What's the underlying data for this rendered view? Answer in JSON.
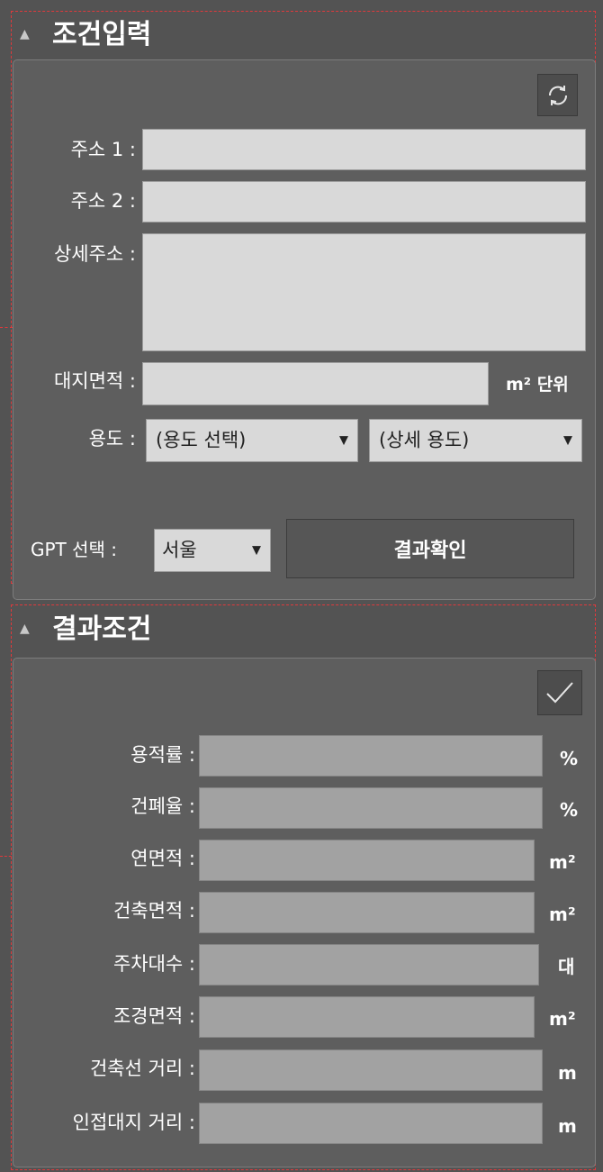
{
  "condition_section": {
    "title": "조건입력",
    "address1_label": "주소 1 :",
    "address2_label": "주소 2 :",
    "detail_address_label": "상세주소 :",
    "site_area_label": "대지면적 :",
    "site_area_unit": "m² 단위",
    "usage_label": "용도 :",
    "usage_select_value": "(용도 선택)",
    "detail_usage_select_value": "(상세 용도)",
    "gpt_label": "GPT 선택 :",
    "gpt_select_value": "서울",
    "confirm_button": "결과확인"
  },
  "result_section": {
    "title": "결과조건",
    "rows": [
      {
        "label": "용적률 :",
        "unit": "%"
      },
      {
        "label": "건폐율 :",
        "unit": "%"
      },
      {
        "label": "연면적 :",
        "unit": "m²"
      },
      {
        "label": "건축면적 :",
        "unit": "m²"
      },
      {
        "label": "주차대수 :",
        "unit": "대"
      },
      {
        "label": "조경면적 :",
        "unit": "m²"
      },
      {
        "label": "건축선 거리 :",
        "unit": "m"
      },
      {
        "label": "인접대지 거리 :",
        "unit": "m"
      }
    ]
  },
  "colors": {
    "background": "#535353",
    "panel": "#5e5e5e",
    "input_light": "#d9d9d9",
    "input_dark": "#a2a2a2",
    "dashed_outline": "#e0393c"
  },
  "icons": {
    "refresh": "refresh-icon",
    "check": "check-icon",
    "collapse": "caret-up-icon",
    "dropdown": "caret-down-icon"
  }
}
